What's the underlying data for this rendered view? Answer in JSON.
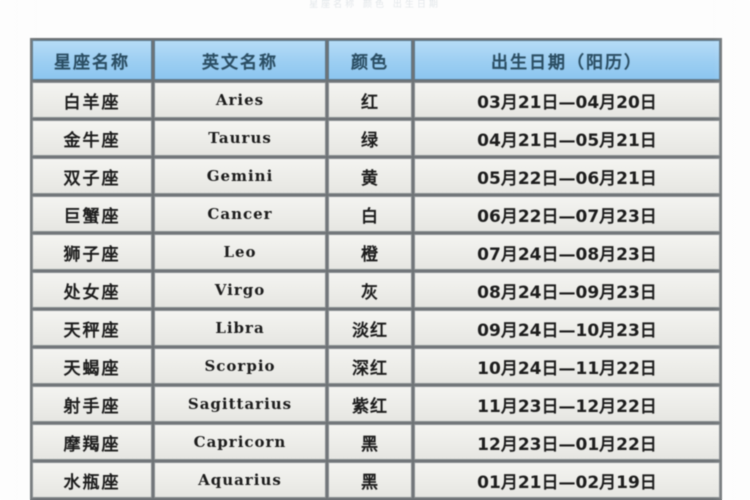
{
  "page": {
    "ghost_text": "星座名称   颜色   出生日期"
  },
  "table": {
    "columns": [
      {
        "key": "cn_name",
        "label": "星座名称"
      },
      {
        "key": "en_name",
        "label": "英文名称"
      },
      {
        "key": "color",
        "label": "颜色"
      },
      {
        "key": "date",
        "label": "出生日期（阳历）"
      }
    ],
    "rows": [
      {
        "cn_name": "白羊座",
        "en_name": "Aries",
        "color": "红",
        "date": "03月21日—04月20日"
      },
      {
        "cn_name": "金牛座",
        "en_name": "Taurus",
        "color": "绿",
        "date": "04月21日—05月21日"
      },
      {
        "cn_name": "双子座",
        "en_name": "Gemini",
        "color": "黄",
        "date": "05月22日—06月21日"
      },
      {
        "cn_name": "巨蟹座",
        "en_name": "Cancer",
        "color": "白",
        "date": "06月22日—07月23日"
      },
      {
        "cn_name": "狮子座",
        "en_name": "Leo",
        "color": "橙",
        "date": "07月24日—08月23日"
      },
      {
        "cn_name": "处女座",
        "en_name": "Virgo",
        "color": "灰",
        "date": "08月24日—09月23日"
      },
      {
        "cn_name": "天秤座",
        "en_name": "Libra",
        "color": "淡红",
        "date": "09月24日—10月23日"
      },
      {
        "cn_name": "天蝎座",
        "en_name": "Scorpio",
        "color": "深红",
        "date": "10月24日—11月22日"
      },
      {
        "cn_name": "射手座",
        "en_name": "Sagittarius",
        "color": "紫红",
        "date": "11月23日—12月22日"
      },
      {
        "cn_name": "摩羯座",
        "en_name": "Capricorn",
        "color": "黑",
        "date": "12月23日—01月22日"
      },
      {
        "cn_name": "水瓶座",
        "en_name": "Aquarius",
        "color": "黑",
        "date": "01月21日—02月19日"
      }
    ]
  },
  "colors": {
    "header_blue": "#a3d3f3",
    "header_text": "#2b4e63",
    "cell_bg": "#eeeeea",
    "cell_text": "#1d1d1d",
    "border": "#6e7376",
    "page_bg": "#fdfdfd"
  }
}
